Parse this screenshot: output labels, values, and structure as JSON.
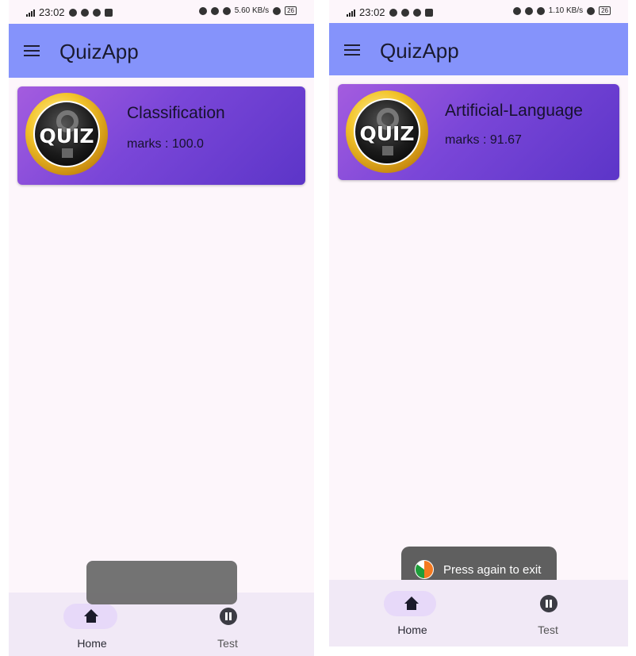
{
  "left_screen": {
    "status": {
      "time": "23:02",
      "network_speed": "5.60 KB/s",
      "battery": "26"
    },
    "app_title": "QuizApp",
    "card": {
      "name": "Classification",
      "marks": "marks : 100.0",
      "logo_text": "QUIZ"
    },
    "nav": {
      "home": "Home",
      "test": "Test"
    }
  },
  "right_screen": {
    "status": {
      "time": "23:02",
      "network_speed": "1.10 KB/s",
      "battery": "26"
    },
    "app_title": "QuizApp",
    "card": {
      "name": "Artificial-Language",
      "marks": "marks : 91.67",
      "logo_text": "QUIZ"
    },
    "toast": "Press again to exit",
    "nav": {
      "home": "Home",
      "test": "Test"
    }
  },
  "colors": {
    "appbar": "#8593fb",
    "card_start": "#a45cdf",
    "card_end": "#5c35c8",
    "bottom_nav": "#f1e9f6",
    "selected_pill": "#e7d9f9"
  }
}
